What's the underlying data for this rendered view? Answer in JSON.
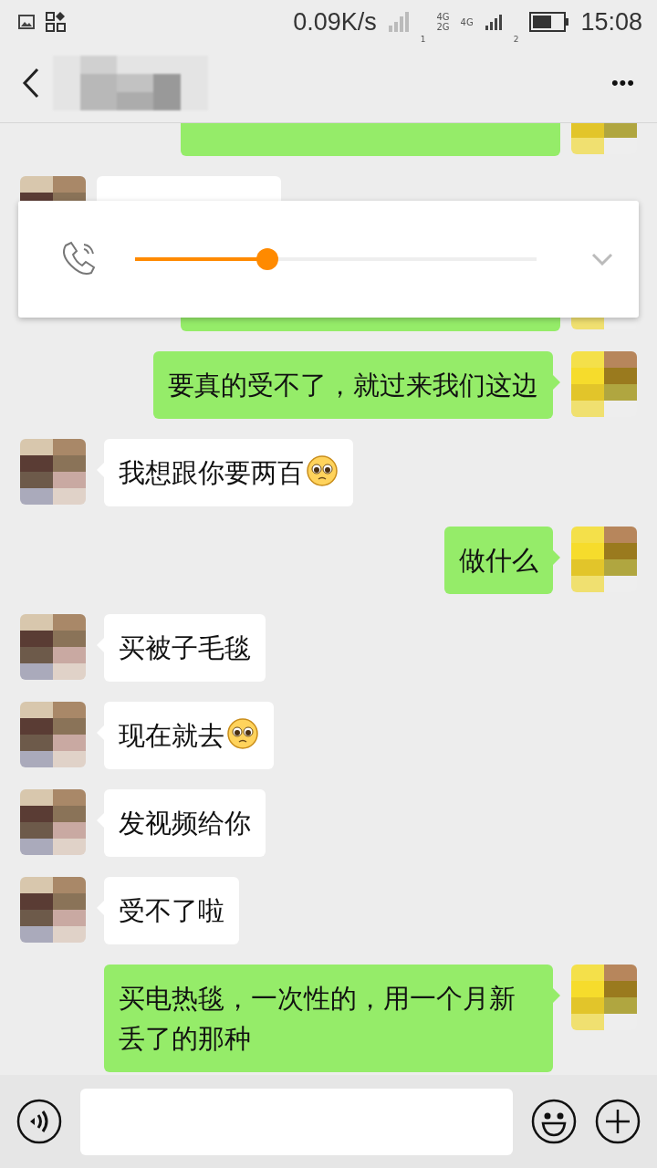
{
  "status_bar": {
    "network_speed": "0.09K/s",
    "sim_labels": [
      "4G",
      "4G",
      "2G"
    ],
    "sim_numbers": [
      "1",
      "2"
    ],
    "time": "15:08"
  },
  "header": {
    "menu": "•••"
  },
  "volume_popup": {
    "level": 0.33
  },
  "messages": [
    {
      "outgoing": true,
      "kind": "cut"
    },
    {
      "outgoing": false,
      "kind": "cut"
    },
    {
      "outgoing": true,
      "kind": "cut"
    },
    {
      "outgoing": true,
      "kind": "text",
      "text": "要真的受不了，就过来我们这边",
      "emoji": false
    },
    {
      "outgoing": false,
      "kind": "text",
      "text": "我想跟你要两百",
      "emoji": true
    },
    {
      "outgoing": true,
      "kind": "text",
      "text": "做什么",
      "emoji": false
    },
    {
      "outgoing": false,
      "kind": "text",
      "text": "买被子毛毯",
      "emoji": false
    },
    {
      "outgoing": false,
      "kind": "text",
      "text": "现在就去",
      "emoji": true
    },
    {
      "outgoing": false,
      "kind": "text",
      "text": "发视频给你",
      "emoji": false
    },
    {
      "outgoing": false,
      "kind": "text",
      "text": "受不了啦",
      "emoji": false
    },
    {
      "outgoing": true,
      "kind": "text",
      "text": "买电热毯，一次性的，用一个月新丢了的那种",
      "emoji": false
    }
  ]
}
